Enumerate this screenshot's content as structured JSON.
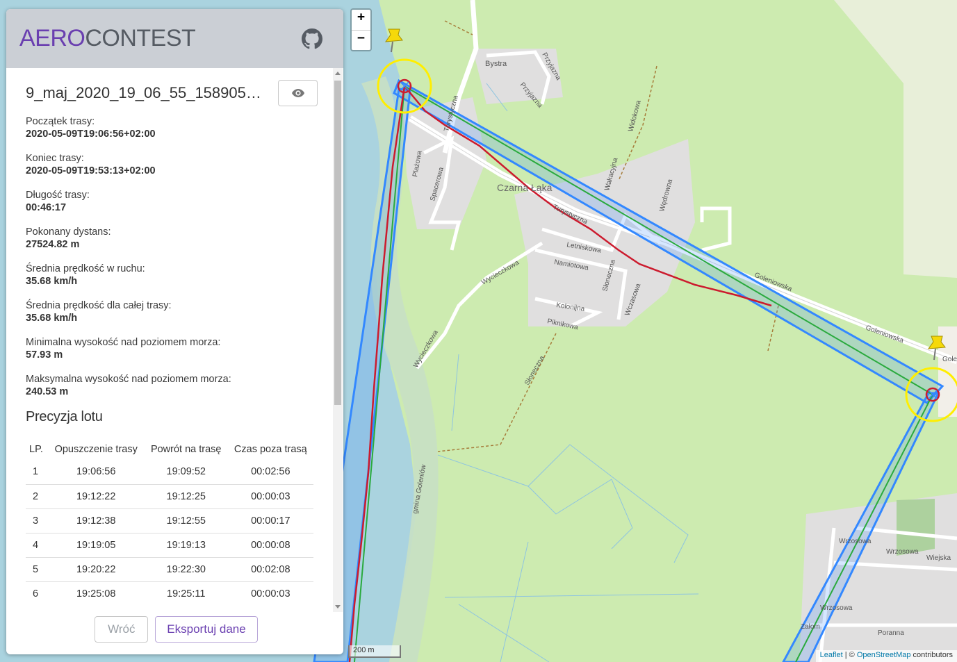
{
  "app": {
    "logo_part1": "AERO",
    "logo_part2": "CONTEST",
    "github_icon": "github-icon"
  },
  "track": {
    "title": "9_maj_2020_19_06_55_1589052...",
    "stats": [
      {
        "label": "Początek trasy:",
        "value": "2020-05-09T19:06:56+02:00"
      },
      {
        "label": "Koniec trasy:",
        "value": "2020-05-09T19:53:13+02:00"
      },
      {
        "label": "Długość trasy:",
        "value": "00:46:17"
      },
      {
        "label": "Pokonany dystans:",
        "value": "27524.82 m"
      },
      {
        "label": "Średnia prędkość w ruchu:",
        "value": "35.68 km/h"
      },
      {
        "label": "Średnia prędkość dla całej trasy:",
        "value": "35.68 km/h"
      },
      {
        "label": "Minimalna wysokość nad poziomem morza:",
        "value": "57.93 m"
      },
      {
        "label": "Maksymalna wysokość nad poziomem morza:",
        "value": "240.53 m"
      }
    ]
  },
  "precision": {
    "title": "Precyzja lotu",
    "headers": [
      "LP.",
      "Opuszczenie trasy",
      "Powrót na trasę",
      "Czas poza trasą"
    ],
    "rows": [
      [
        "1",
        "19:06:56",
        "19:09:52",
        "00:02:56"
      ],
      [
        "2",
        "19:12:22",
        "19:12:25",
        "00:00:03"
      ],
      [
        "3",
        "19:12:38",
        "19:12:55",
        "00:00:17"
      ],
      [
        "4",
        "19:19:05",
        "19:19:13",
        "00:00:08"
      ],
      [
        "5",
        "19:20:22",
        "19:22:30",
        "00:02:08"
      ],
      [
        "6",
        "19:25:08",
        "19:25:11",
        "00:00:03"
      ]
    ]
  },
  "buttons": {
    "back": "Wróć",
    "export": "Eksportuj dane"
  },
  "map": {
    "zoom_in": "+",
    "zoom_out": "−",
    "scale": "200 m",
    "attribution_leaflet": "Leaflet",
    "attribution_sep": " | © ",
    "attribution_osm": "OpenStreetMap",
    "attribution_tail": " contributors",
    "labels": {
      "village": "Czarna Łąka",
      "bystra": "Bystra",
      "przyjazna": "Przyjazna",
      "turystyczna": "Turystyczna",
      "goleniowska": "Goleniowska",
      "letniskowa": "Letniskowa",
      "namiotowa": "Namiotowa",
      "kolonijna": "Kolonijna",
      "piknikowa": "Piknikowa",
      "wycieczkowa": "Wycieczkowa",
      "sloneczna": "Słoneczna",
      "wrzosowa": "Wrzosowa",
      "wiejska": "Wiejska",
      "poranna": "Poranna",
      "zalom": "Załom",
      "gmina": "gmina Goleniów",
      "plazowa": "Plażowa",
      "spacerowa": "Spacerowa",
      "wakacyjna": "Wakacyjna",
      "widokowa": "Widokowa",
      "wedrowna": "Wędrowna",
      "wczasowa": "Wczasowa",
      "gole": "Gole"
    },
    "colors": {
      "route": "#3388ff",
      "track": "#cc1b2e",
      "turnpoint": "#ffee00",
      "land": "#cdebb0",
      "water": "#aad3df"
    }
  }
}
